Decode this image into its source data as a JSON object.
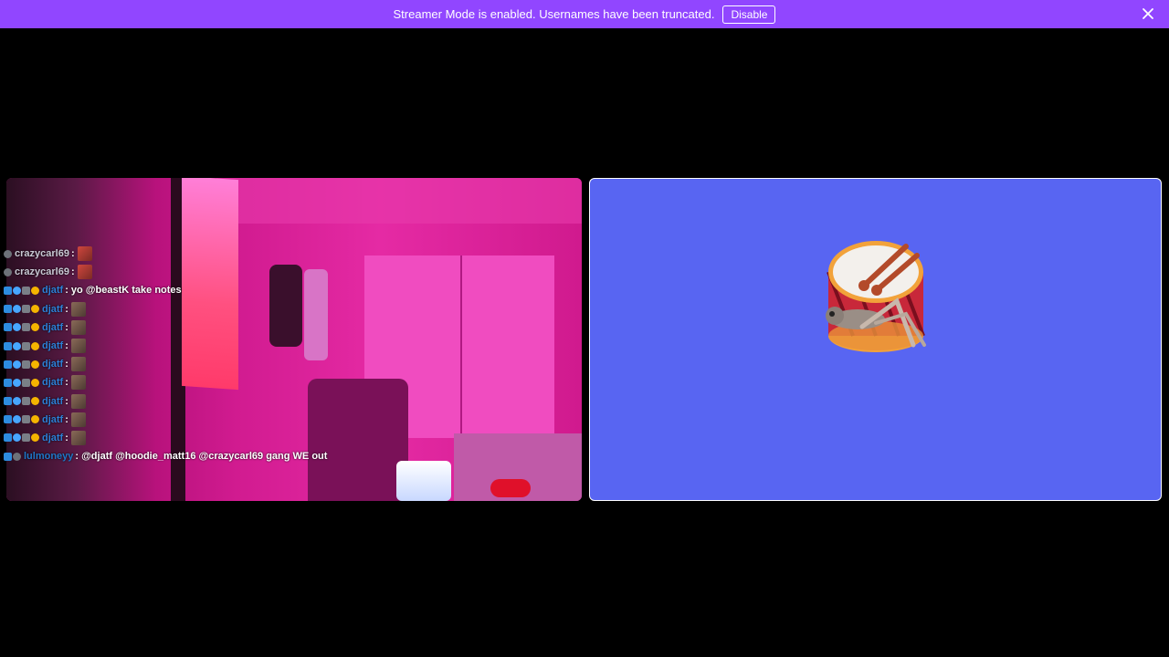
{
  "banner": {
    "message": "Streamer Mode is enabled. Usernames have been truncated.",
    "disable_label": "Disable",
    "color": "#9146ff"
  },
  "stream_tiles": {
    "left": {
      "kind": "webcam-video"
    },
    "right": {
      "kind": "avatar-placeholder",
      "background": "#5865f2",
      "avatar_icon": "cricket-on-drum-icon"
    }
  },
  "chat": {
    "lines": [
      {
        "user": "crazycarl69",
        "badges": [
          "bot"
        ],
        "message": "",
        "emote": "red-emote"
      },
      {
        "user": "crazycarl69",
        "badges": [
          "bot"
        ],
        "message": "",
        "emote": "red-emote"
      },
      {
        "user": "djatf",
        "badges": [
          "mod",
          "blue",
          "gray",
          "gold"
        ],
        "message": "yo @beastK take notes",
        "emote": ""
      },
      {
        "user": "djatf",
        "badges": [
          "mod",
          "blue",
          "gray",
          "gold"
        ],
        "message": "",
        "emote": "face-emote"
      },
      {
        "user": "djatf",
        "badges": [
          "mod",
          "blue",
          "gray",
          "gold"
        ],
        "message": "",
        "emote": "face-emote"
      },
      {
        "user": "djatf",
        "badges": [
          "mod",
          "blue",
          "gray",
          "gold"
        ],
        "message": "",
        "emote": "face-emote"
      },
      {
        "user": "djatf",
        "badges": [
          "mod",
          "blue",
          "gray",
          "gold"
        ],
        "message": "",
        "emote": "face-emote"
      },
      {
        "user": "djatf",
        "badges": [
          "mod",
          "blue",
          "gray",
          "gold"
        ],
        "message": "",
        "emote": "face-emote"
      },
      {
        "user": "djatf",
        "badges": [
          "mod",
          "blue",
          "gray",
          "gold"
        ],
        "message": "",
        "emote": "face-emote"
      },
      {
        "user": "djatf",
        "badges": [
          "mod",
          "blue",
          "gray",
          "gold"
        ],
        "message": "",
        "emote": "face-emote"
      },
      {
        "user": "djatf",
        "badges": [
          "mod",
          "blue",
          "gray",
          "gold"
        ],
        "message": "",
        "emote": "face-emote"
      },
      {
        "user": "lulmoneyy",
        "badges": [
          "mod",
          "bot"
        ],
        "message": "@djatf @hoodie_matt16 @crazycarl69 gang WE out",
        "emote": ""
      }
    ]
  }
}
